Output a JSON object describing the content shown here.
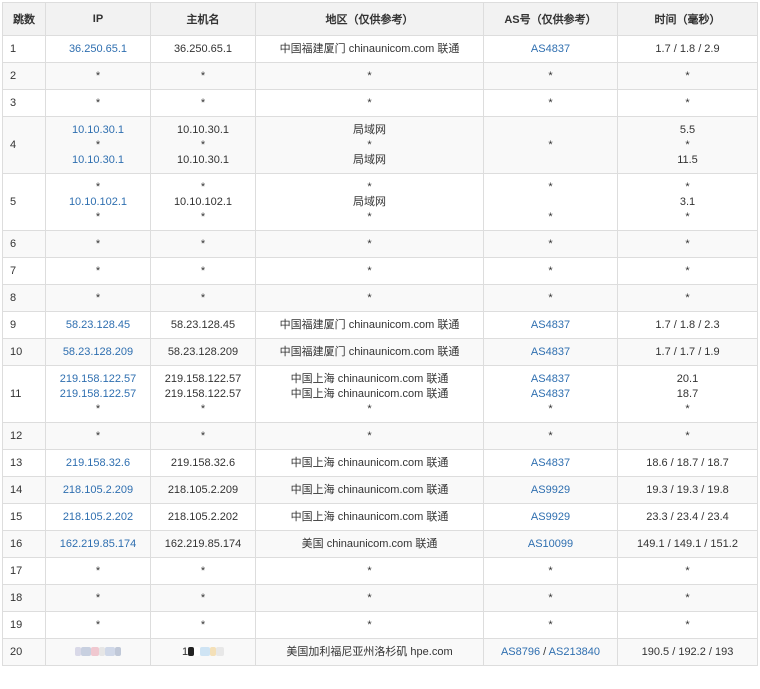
{
  "headers": {
    "hop": "跳数",
    "ip": "IP",
    "host": "主机名",
    "region": "地区（仅供参考）",
    "as": "AS号（仅供参考）",
    "time": "时间（毫秒）"
  },
  "rows": [
    {
      "hop": "1",
      "ip": [
        "36.250.65.1"
      ],
      "host": [
        "36.250.65.1"
      ],
      "region": [
        "中国福建厦门 chinaunicom.com 联通"
      ],
      "as": [
        "AS4837"
      ],
      "time": [
        "1.7 / 1.8 / 2.9"
      ]
    },
    {
      "hop": "2",
      "ip": [
        "*"
      ],
      "host": [
        "*"
      ],
      "region": [
        "*"
      ],
      "as": [
        "*"
      ],
      "time": [
        "*"
      ]
    },
    {
      "hop": "3",
      "ip": [
        "*"
      ],
      "host": [
        "*"
      ],
      "region": [
        "*"
      ],
      "as": [
        "*"
      ],
      "time": [
        "*"
      ]
    },
    {
      "hop": "4",
      "ip": [
        "10.10.30.1",
        "*",
        "10.10.30.1"
      ],
      "host": [
        "10.10.30.1",
        "*",
        "10.10.30.1"
      ],
      "region": [
        "局域网",
        "*",
        "局域网"
      ],
      "as": [
        "*"
      ],
      "time": [
        "5.5",
        "*",
        "11.5"
      ]
    },
    {
      "hop": "5",
      "ip": [
        "*",
        "10.10.102.1",
        "*"
      ],
      "host": [
        "*",
        "10.10.102.1",
        "*"
      ],
      "region": [
        "*",
        "局域网",
        "*"
      ],
      "as": [
        "*",
        "",
        "*"
      ],
      "time": [
        "*",
        "3.1",
        "*"
      ]
    },
    {
      "hop": "6",
      "ip": [
        "*"
      ],
      "host": [
        "*"
      ],
      "region": [
        "*"
      ],
      "as": [
        "*"
      ],
      "time": [
        "*"
      ]
    },
    {
      "hop": "7",
      "ip": [
        "*"
      ],
      "host": [
        "*"
      ],
      "region": [
        "*"
      ],
      "as": [
        "*"
      ],
      "time": [
        "*"
      ]
    },
    {
      "hop": "8",
      "ip": [
        "*"
      ],
      "host": [
        "*"
      ],
      "region": [
        "*"
      ],
      "as": [
        "*"
      ],
      "time": [
        "*"
      ]
    },
    {
      "hop": "9",
      "ip": [
        "58.23.128.45"
      ],
      "host": [
        "58.23.128.45"
      ],
      "region": [
        "中国福建厦门 chinaunicom.com 联通"
      ],
      "as": [
        "AS4837"
      ],
      "time": [
        "1.7 / 1.8 / 2.3"
      ]
    },
    {
      "hop": "10",
      "ip": [
        "58.23.128.209"
      ],
      "host": [
        "58.23.128.209"
      ],
      "region": [
        "中国福建厦门 chinaunicom.com 联通"
      ],
      "as": [
        "AS4837"
      ],
      "time": [
        "1.7 / 1.7 / 1.9"
      ]
    },
    {
      "hop": "11",
      "ip": [
        "219.158.122.57",
        "219.158.122.57",
        "*"
      ],
      "host": [
        "219.158.122.57",
        "219.158.122.57",
        "*"
      ],
      "region": [
        "中国上海 chinaunicom.com 联通",
        "中国上海 chinaunicom.com 联通",
        "*"
      ],
      "as": [
        "AS4837",
        "AS4837",
        "*"
      ],
      "time": [
        "20.1",
        "18.7",
        "*"
      ]
    },
    {
      "hop": "12",
      "ip": [
        "*"
      ],
      "host": [
        "*"
      ],
      "region": [
        "*"
      ],
      "as": [
        "*"
      ],
      "time": [
        "*"
      ]
    },
    {
      "hop": "13",
      "ip": [
        "219.158.32.6"
      ],
      "host": [
        "219.158.32.6"
      ],
      "region": [
        "中国上海 chinaunicom.com 联通"
      ],
      "as": [
        "AS4837"
      ],
      "time": [
        "18.6 / 18.7 / 18.7"
      ]
    },
    {
      "hop": "14",
      "ip": [
        "218.105.2.209"
      ],
      "host": [
        "218.105.2.209"
      ],
      "region": [
        "中国上海 chinaunicom.com 联通"
      ],
      "as": [
        "AS9929"
      ],
      "time": [
        "19.3 / 19.3 / 19.8"
      ]
    },
    {
      "hop": "15",
      "ip": [
        "218.105.2.202"
      ],
      "host": [
        "218.105.2.202"
      ],
      "region": [
        "中国上海 chinaunicom.com 联通"
      ],
      "as": [
        "AS9929"
      ],
      "time": [
        "23.3 / 23.4 / 23.4"
      ]
    },
    {
      "hop": "16",
      "ip": [
        "162.219.85.174"
      ],
      "host": [
        "162.219.85.174"
      ],
      "region": [
        "美国 chinaunicom.com 联通"
      ],
      "as": [
        "AS10099"
      ],
      "time": [
        "149.1 / 149.1 / 151.2"
      ]
    },
    {
      "hop": "17",
      "ip": [
        "*"
      ],
      "host": [
        "*"
      ],
      "region": [
        "*"
      ],
      "as": [
        "*"
      ],
      "time": [
        "*"
      ]
    },
    {
      "hop": "18",
      "ip": [
        "*"
      ],
      "host": [
        "*"
      ],
      "region": [
        "*"
      ],
      "as": [
        "*"
      ],
      "time": [
        "*"
      ]
    },
    {
      "hop": "19",
      "ip": [
        "*"
      ],
      "host": [
        "*"
      ],
      "region": [
        "*"
      ],
      "as": [
        "*"
      ],
      "time": [
        "*"
      ]
    },
    {
      "hop": "20",
      "ip": [
        "__blur__"
      ],
      "host": [
        "__blur__"
      ],
      "region": [
        "美国加利福尼亚州洛杉矶 hpe.com"
      ],
      "as": [
        "AS8796",
        "/",
        "AS213840"
      ],
      "time": [
        "190.5 / 192.2 / 193"
      ]
    }
  ],
  "colors": {
    "link": "#2f6fb0",
    "header_bg": "#f2f2f2",
    "border": "#dddddd",
    "stripe": "#f9f9f9"
  }
}
